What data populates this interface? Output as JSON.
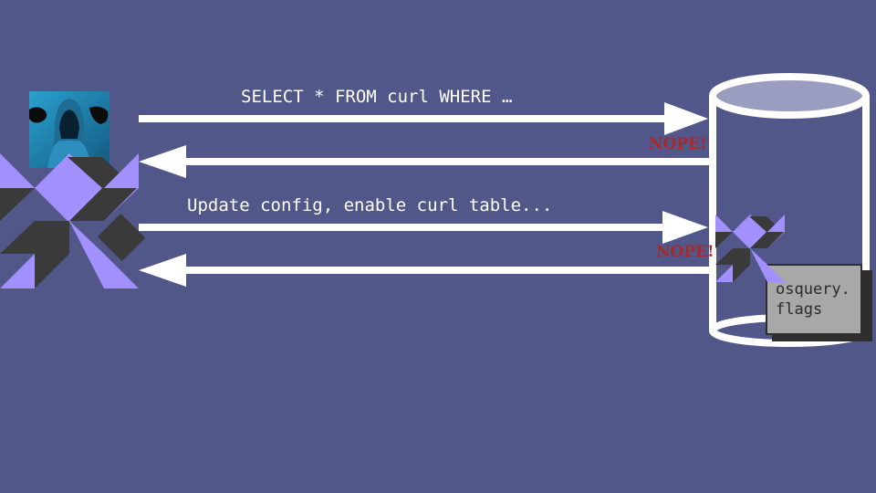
{
  "messages": {
    "query": "SELECT * FROM curl WHERE …",
    "update": "Update config, enable curl table...",
    "nope_1": "NOPE!",
    "nope_2": "NOPE!"
  },
  "host": {
    "config_file_line1": "osquery.",
    "config_file_line2": "flags"
  },
  "icons": {
    "attacker": "hooded-hacker-avatar",
    "osquery_logo": "osquery-logo-icon",
    "database": "database-cylinder-icon",
    "file": "config-file-icon"
  },
  "colors": {
    "background": "#515788",
    "arrow": "#ffffff",
    "logo_purple": "#a390ff",
    "logo_dark": "#3a3a3a",
    "nope": "#a52a2a",
    "file_fill": "#a8a8a8"
  }
}
